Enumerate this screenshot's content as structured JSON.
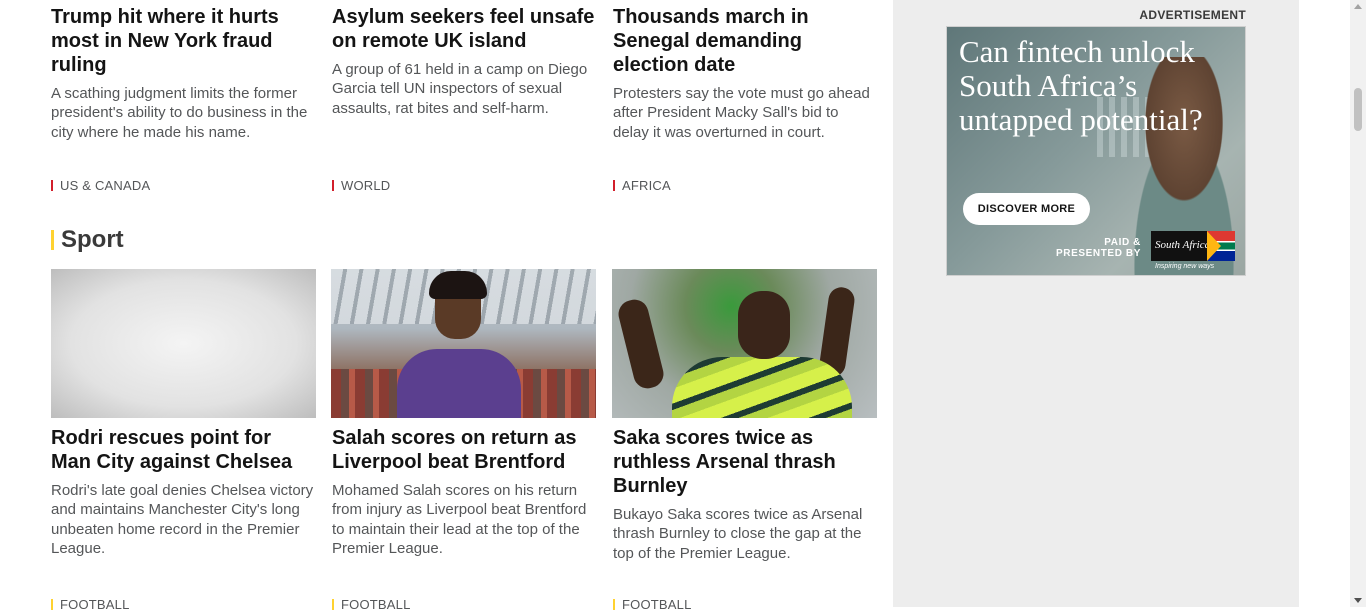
{
  "news_row": [
    {
      "headline": "Trump hit where it hurts most in New York fraud ruling",
      "summary": "A scathing judgment limits the former president's ability to do business in the city where he made his name.",
      "tag": "US & CANADA"
    },
    {
      "headline": "Asylum seekers feel unsafe on remote UK island",
      "summary": "A group of 61 held in a camp on Diego Garcia tell UN inspectors of sexual assaults, rat bites and self-harm.",
      "tag": "WORLD"
    },
    {
      "headline": "Thousands march in Senegal demanding election date",
      "summary": "Protesters say the vote must go ahead after President Macky Sall's bid to delay it was overturned in court.",
      "tag": "AFRICA"
    }
  ],
  "sport_section": {
    "title": "Sport",
    "items": [
      {
        "headline": "Rodri rescues point for Man City against Chelsea",
        "summary": "Rodri's late goal denies Chelsea victory and maintains Manchester City's long unbeaten home record in the Premier League.",
        "tag": "FOOTBALL"
      },
      {
        "headline": "Salah scores on return as Liverpool beat Brentford",
        "summary": "Mohamed Salah scores on his return from injury as Liverpool beat Brentford to maintain their lead at the top of the Premier League.",
        "tag": "FOOTBALL"
      },
      {
        "headline": "Saka scores twice as ruthless Arsenal thrash Burnley",
        "summary": "Bukayo Saka scores twice as Arsenal thrash Burnley to close the gap at the top of the Premier League.",
        "tag": "FOOTBALL"
      }
    ]
  },
  "advertisement": {
    "label": "ADVERTISEMENT",
    "headline": "Can fintech unlock South Africa’s untapped potential?",
    "button": "DISCOVER MORE",
    "paid_line1": "PAID &",
    "paid_line2": "PRESENTED BY",
    "logo_text": "South Africa",
    "logo_tagline": "Inspiring new ways"
  },
  "colors": {
    "news_tag_accent": "#d21f2b",
    "sport_accent": "#ffd230",
    "sidebar_bg": "#ededed"
  }
}
